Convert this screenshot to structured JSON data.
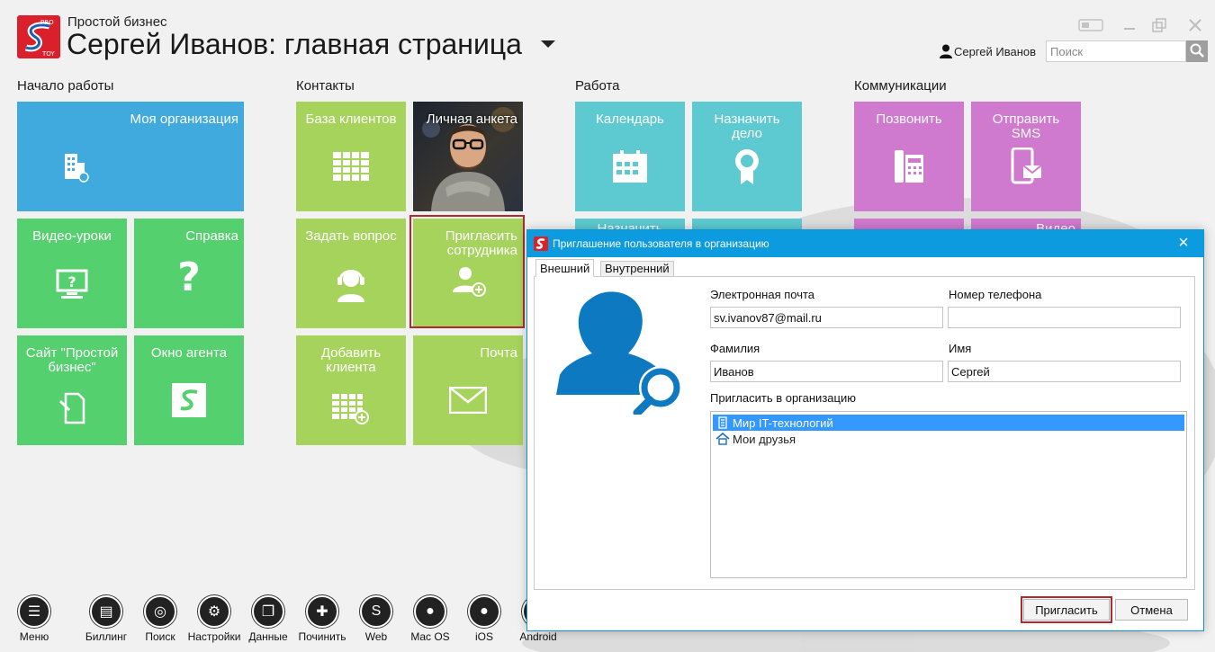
{
  "app": {
    "name": "Простой бизнес",
    "title": "Сергей Иванов: главная страница"
  },
  "user": {
    "name": "Сергей Иванов"
  },
  "search": {
    "placeholder": "Поиск"
  },
  "groups": {
    "start": {
      "title": "Начало работы",
      "tiles": {
        "my_org": "Моя организация",
        "video": "Видео-уроки",
        "help": "Справка",
        "site": "Сайт \"Простой бизнес\"",
        "agent": "Окно агента"
      }
    },
    "contacts": {
      "title": "Контакты",
      "tiles": {
        "clients": "База клиентов",
        "profile": "Личная анкета",
        "ask": "Задать вопрос",
        "invite": "Пригласить сотрудника",
        "add_client": "Добавить клиента",
        "mail": "Почта"
      }
    },
    "work": {
      "title": "Работа",
      "tiles": {
        "calendar": "Календарь",
        "assign": "Назначить дело",
        "hidden1": "Назначить"
      }
    },
    "comm": {
      "title": "Коммуникации",
      "tiles": {
        "call": "Позвонить",
        "sms": "Отправить SMS",
        "hidden1": "Видео"
      }
    }
  },
  "taskbar": [
    {
      "label": "Меню"
    },
    {
      "label": "Биллинг"
    },
    {
      "label": "Поиск"
    },
    {
      "label": "Настройки"
    },
    {
      "label": "Данные"
    },
    {
      "label": "Починить"
    },
    {
      "label": "Web"
    },
    {
      "label": "Mac OS"
    },
    {
      "label": "iOS"
    },
    {
      "label": "Android"
    }
  ],
  "dialog": {
    "title": "Приглашение пользователя в организацию",
    "tabs": {
      "external": "Внешний",
      "internal": "Внутренний"
    },
    "email": {
      "label": "Электронная почта",
      "value": "sv.ivanov87@mail.ru"
    },
    "phone": {
      "label": "Номер телефона",
      "value": ""
    },
    "last_name": {
      "label": "Фамилия",
      "value": "Иванов"
    },
    "first_name": {
      "label": "Имя",
      "value": "Сергей"
    },
    "org_label": "Пригласить в организацию",
    "orgs": [
      {
        "name": "Мир IT-технологий",
        "icon": "building-icon",
        "selected": true
      },
      {
        "name": "Мои друзья",
        "icon": "home-icon",
        "selected": false
      }
    ],
    "buttons": {
      "invite": "Пригласить",
      "cancel": "Отмена"
    }
  },
  "colors": {
    "green": "#55d06e",
    "lime": "#a6d35b",
    "blue": "#40a9de",
    "teal": "#5ccad0",
    "pink": "#cf79cf",
    "dialog_title": "#0c9bdf",
    "highlight": "#b3292e"
  }
}
